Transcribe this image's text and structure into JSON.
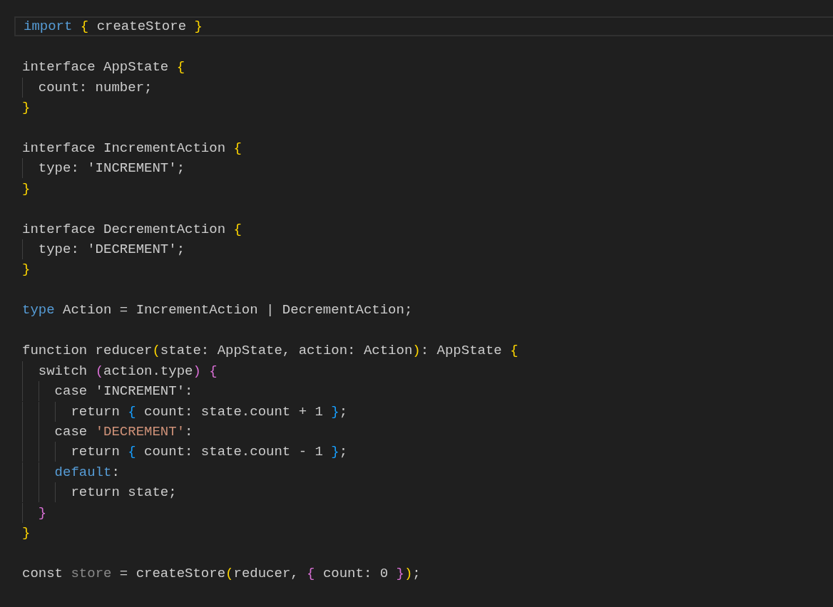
{
  "editor": {
    "lines": [
      {
        "current": true,
        "tokens": [
          {
            "text": "import ",
            "kind": "keyword"
          },
          {
            "text": "{",
            "kind": "bracket1"
          },
          {
            "text": " createStore ",
            "kind": "plain"
          },
          {
            "text": "}",
            "kind": "bracket1"
          }
        ]
      },
      {
        "current": false
      },
      {
        "current": false,
        "tokens": [
          {
            "text": "interface AppState ",
            "kind": "plain"
          },
          {
            "text": "{",
            "kind": "bracket1"
          }
        ]
      },
      {
        "current": false,
        "tokens": [
          {
            "text": "  count: number;",
            "kind": "plain"
          }
        ]
      },
      {
        "current": false,
        "tokens": [
          {
            "text": "}",
            "kind": "bracket1"
          }
        ]
      },
      {
        "current": false
      },
      {
        "current": false,
        "tokens": [
          {
            "text": "interface IncrementAction ",
            "kind": "plain"
          },
          {
            "text": "{",
            "kind": "bracket1"
          }
        ]
      },
      {
        "current": false,
        "tokens": [
          {
            "text": "  type: 'INCREMENT';",
            "kind": "plain"
          }
        ]
      },
      {
        "current": false,
        "tokens": [
          {
            "text": "}",
            "kind": "bracket1"
          }
        ]
      },
      {
        "current": false
      },
      {
        "current": false,
        "tokens": [
          {
            "text": "interface DecrementAction ",
            "kind": "plain"
          },
          {
            "text": "{",
            "kind": "bracket1"
          }
        ]
      },
      {
        "current": false,
        "tokens": [
          {
            "text": "  type: 'DECREMENT';",
            "kind": "plain"
          }
        ]
      },
      {
        "current": false,
        "tokens": [
          {
            "text": "}",
            "kind": "bracket1"
          }
        ]
      },
      {
        "current": false
      },
      {
        "current": false,
        "tokens": [
          {
            "text": "type",
            "kind": "keyword"
          },
          {
            "text": " Action = IncrementAction | DecrementAction;",
            "kind": "plain"
          }
        ]
      },
      {
        "current": false
      },
      {
        "current": false,
        "tokens": [
          {
            "text": "function reducer",
            "kind": "plain"
          },
          {
            "text": "(",
            "kind": "bracket1"
          },
          {
            "text": "state: AppState, action: Action",
            "kind": "plain"
          },
          {
            "text": ")",
            "kind": "bracket1"
          },
          {
            "text": ": AppState ",
            "kind": "plain"
          },
          {
            "text": "{",
            "kind": "bracket1"
          }
        ]
      },
      {
        "current": false,
        "tokens": [
          {
            "text": "  switch ",
            "kind": "plain"
          },
          {
            "text": "(",
            "kind": "bracket2"
          },
          {
            "text": "action.type",
            "kind": "plain"
          },
          {
            "text": ") ",
            "kind": "bracket2"
          },
          {
            "text": "{",
            "kind": "bracket2"
          }
        ]
      },
      {
        "current": false,
        "tokens": [
          {
            "text": "    case 'INCREMENT':",
            "kind": "plain"
          }
        ]
      },
      {
        "current": false,
        "tokens": [
          {
            "text": "      return ",
            "kind": "plain"
          },
          {
            "text": "{",
            "kind": "bracket3"
          },
          {
            "text": " count: state.count + 1 ",
            "kind": "plain"
          },
          {
            "text": "}",
            "kind": "bracket3"
          },
          {
            "text": ";",
            "kind": "plain"
          }
        ]
      },
      {
        "current": false,
        "tokens": [
          {
            "text": "    case ",
            "kind": "plain"
          },
          {
            "text": "'DECREMENT'",
            "kind": "string"
          },
          {
            "text": ":",
            "kind": "plain"
          }
        ]
      },
      {
        "current": false,
        "tokens": [
          {
            "text": "      return ",
            "kind": "plain"
          },
          {
            "text": "{",
            "kind": "bracket3"
          },
          {
            "text": " count: state.count - 1 ",
            "kind": "plain"
          },
          {
            "text": "}",
            "kind": "bracket3"
          },
          {
            "text": ";",
            "kind": "plain"
          }
        ]
      },
      {
        "current": false,
        "tokens": [
          {
            "text": "    default",
            "kind": "keyword"
          },
          {
            "text": ":",
            "kind": "plain"
          }
        ]
      },
      {
        "current": false,
        "tokens": [
          {
            "text": "      return state;",
            "kind": "plain"
          }
        ]
      },
      {
        "current": false,
        "tokens": [
          {
            "text": "  }",
            "kind": "bracket2"
          }
        ]
      },
      {
        "current": false,
        "tokens": [
          {
            "text": "}",
            "kind": "bracket1"
          }
        ]
      },
      {
        "current": false
      },
      {
        "current": false,
        "tokens": [
          {
            "text": "const ",
            "kind": "plain"
          },
          {
            "text": "store",
            "kind": "unused"
          },
          {
            "text": " = createStore",
            "kind": "plain"
          },
          {
            "text": "(",
            "kind": "bracket1"
          },
          {
            "text": "reducer, ",
            "kind": "plain"
          },
          {
            "text": "{",
            "kind": "bracket2"
          },
          {
            "text": " count: 0 ",
            "kind": "plain"
          },
          {
            "text": "}",
            "kind": "bracket2"
          },
          {
            "text": ")",
            "kind": "bracket1"
          },
          {
            "text": ";",
            "kind": "plain"
          }
        ]
      }
    ]
  }
}
